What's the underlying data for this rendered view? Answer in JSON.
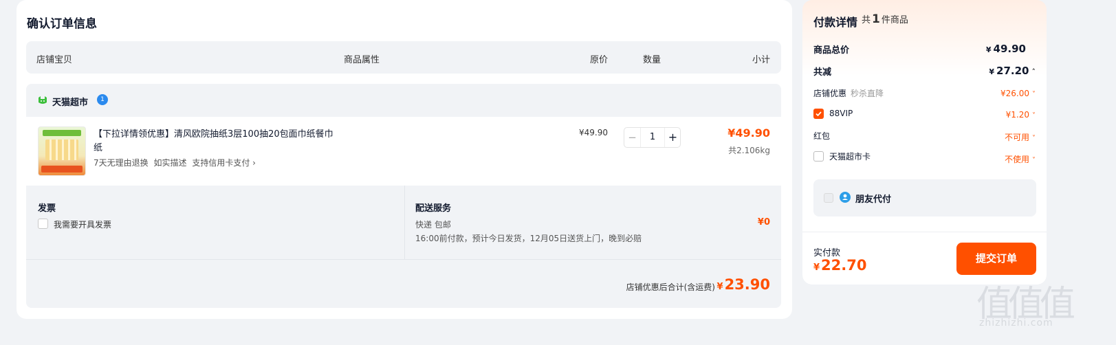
{
  "order": {
    "title": "确认订单信息",
    "headers": {
      "store_item": "店铺宝贝",
      "attributes": "商品属性",
      "orig_price": "原价",
      "quantity": "数量",
      "subtotal": "小计"
    },
    "store": {
      "name": "天猫超市",
      "badge": "1",
      "icon": "tmall-cat-icon"
    },
    "product": {
      "title": "【下拉详情领优惠】清风欧院抽纸3层100抽20包面巾纸餐巾纸",
      "services": [
        "7天无理由退换",
        "如实描述",
        "支持信用卡支付 ›"
      ],
      "orig_price": "¥49.90",
      "quantity": "1",
      "qty_minus": "−",
      "qty_plus": "+",
      "subtotal": "¥49.90",
      "weight": "共2.106kg"
    },
    "invoice": {
      "title": "发票",
      "checkbox_label": "我需要开具发票"
    },
    "delivery": {
      "title": "配送服务",
      "method": "快递 包邮",
      "detail": "16:00前付款，预计今日发货，12月05日送货上门，晚到必赔",
      "fee": "¥0"
    },
    "store_total": {
      "label": "店铺优惠后合计(含运费)",
      "currency": "¥",
      "value": "23.90"
    }
  },
  "payment": {
    "title": "付款详情",
    "count_prefix": "共",
    "count": "1",
    "count_suffix": "件商品",
    "goods_total": {
      "label": "商品总价",
      "currency": "¥",
      "value": "49.90"
    },
    "discount": {
      "label": "共减",
      "currency": "¥",
      "value": "27.20",
      "chevron": "˄"
    },
    "shop_discount": {
      "label": "店铺优惠",
      "tag": "秒杀直降",
      "value": "¥26.00",
      "chevron": "˅"
    },
    "vip": {
      "label": "88VIP",
      "value": "¥1.20",
      "checked": true,
      "chevron": "˅"
    },
    "red_packet": {
      "label": "红包",
      "value": "不可用",
      "chevron": "˅"
    },
    "tmall_card": {
      "label": "天猫超市卡",
      "value": "不使用",
      "chevron": "˅"
    },
    "friend_pay": {
      "label": "朋友代付"
    },
    "actual": {
      "label": "实付款",
      "currency": "¥",
      "value": "22.70"
    },
    "submit_label": "提交订单"
  },
  "watermark": {
    "glyphs": "值值值",
    "text": "zhizhizhi.com"
  },
  "colors": {
    "accent": "#ff5000",
    "background": "#f1f3f6",
    "card": "#ffffff",
    "text": "#11192d"
  }
}
